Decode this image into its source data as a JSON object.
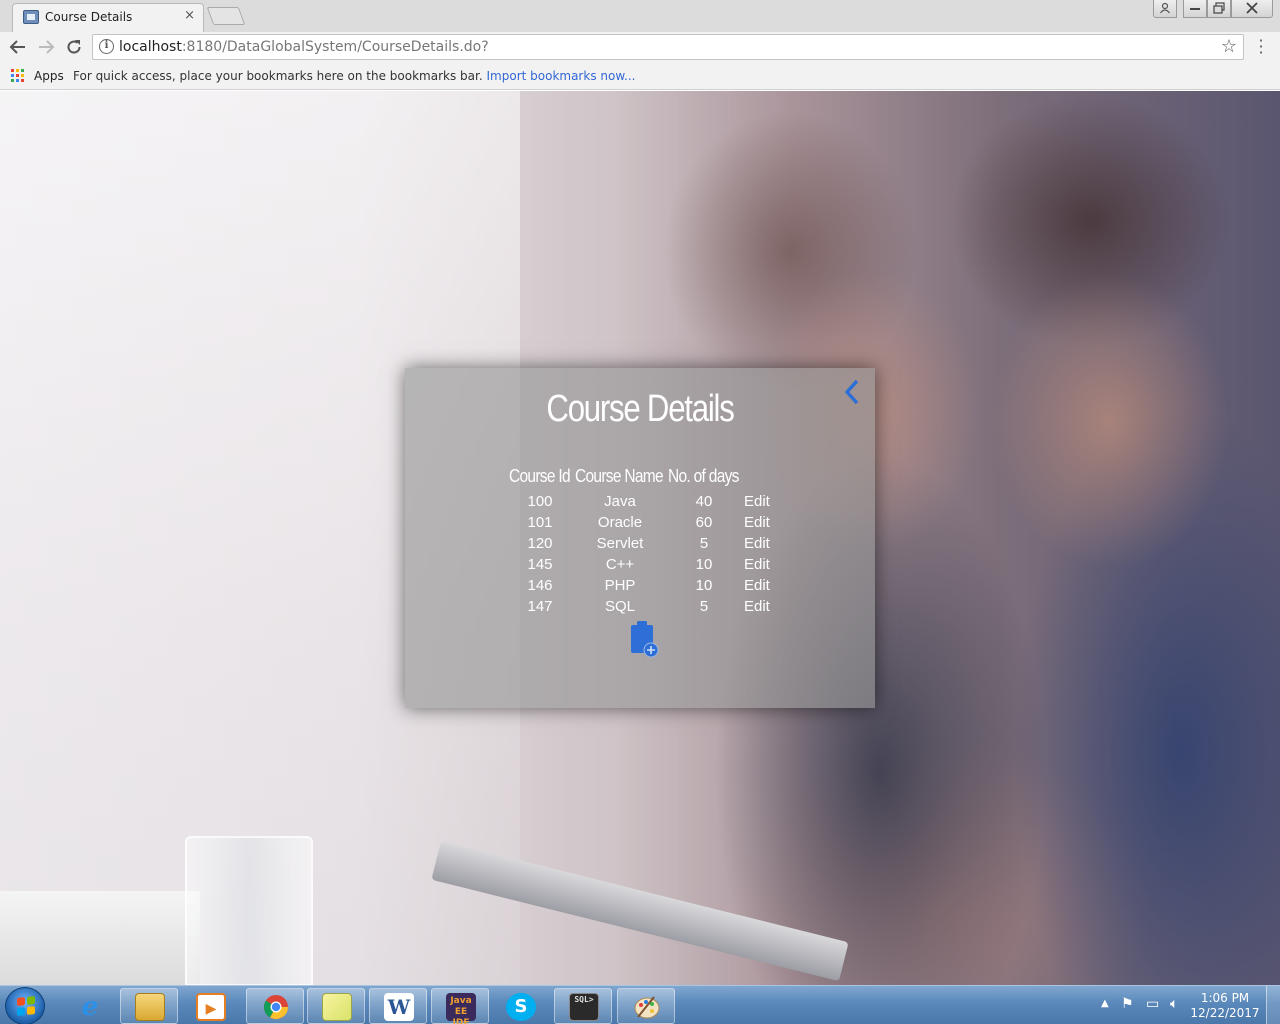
{
  "browser": {
    "tab_title": "Course Details",
    "tab_close": "×",
    "url_host": "localhost",
    "url_rest": ":8180/DataGlobalSystem/CourseDetails.do?",
    "bookmarks_apps": "Apps",
    "bookmarks_hint": "For quick access, place your bookmarks here on the bookmarks bar.",
    "bookmarks_import": "Import bookmarks now...",
    "icons": [
      "back-arrow-icon",
      "forward-arrow-icon",
      "reload-icon",
      "info-icon",
      "star-icon",
      "menu-icon"
    ]
  },
  "card": {
    "title": "Course Details",
    "headers": [
      "Course Id",
      "Course Name",
      "No. of days"
    ],
    "rows": [
      {
        "id": "100",
        "name": "Java",
        "days": "40",
        "action": "Edit"
      },
      {
        "id": "101",
        "name": "Oracle",
        "days": "60",
        "action": "Edit"
      },
      {
        "id": "120",
        "name": "Servlet",
        "days": "5",
        "action": "Edit"
      },
      {
        "id": "145",
        "name": "C++",
        "days": "10",
        "action": "Edit"
      },
      {
        "id": "146",
        "name": "PHP",
        "days": "10",
        "action": "Edit"
      },
      {
        "id": "147",
        "name": "SQL",
        "days": "5",
        "action": "Edit"
      }
    ],
    "accent_color": "#2d6fd6"
  },
  "taskbar": {
    "apps": [
      "internet-explorer",
      "file-explorer",
      "media-player",
      "chrome",
      "sticky-notes",
      "word",
      "java-ee-ide",
      "skype",
      "sql-plus",
      "paint"
    ],
    "time": "1:06 PM",
    "date": "12/22/2017"
  }
}
